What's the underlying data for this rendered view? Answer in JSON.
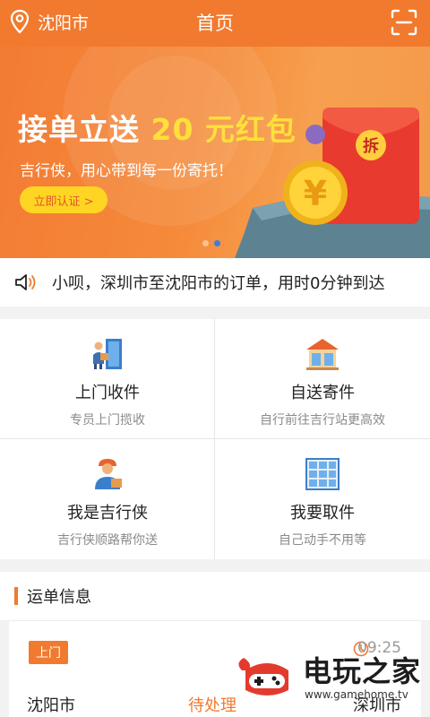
{
  "header": {
    "location": "沈阳市",
    "title": "首页",
    "location_icon": "location-pin-icon",
    "scan_icon": "scan-icon"
  },
  "banner": {
    "headline_prefix": "接单立送",
    "headline_highlight": "20 元红包",
    "subtitle": "吉行侠，用心带到每一份寄托！",
    "cta": "立即认证 >",
    "envelope_char": "拆",
    "coin_char": "¥",
    "slide_count": 2,
    "active_slide": 2
  },
  "notice": {
    "icon": "speaker-icon",
    "text": "小呗，深圳市至沈阳市的订单，用时0分钟到达"
  },
  "services": [
    {
      "label": "上门收件",
      "sub": "专员上门揽收",
      "icon": "courier-door-icon"
    },
    {
      "label": "自送寄件",
      "sub": "自行前往吉行站更高效",
      "icon": "station-icon"
    },
    {
      "label": "我是吉行侠",
      "sub": "吉行侠顺路帮你送",
      "icon": "courier-person-icon"
    },
    {
      "label": "我要取件",
      "sub": "自己动手不用等",
      "icon": "locker-icon"
    }
  ],
  "waybill": {
    "section_title": "运单信息",
    "tag": "上门",
    "time": "09:25",
    "from": "沈阳市",
    "status": "待处理",
    "to": "深圳市"
  },
  "watermark": {
    "name": "电玩之家",
    "url": "www.gamehome.tv"
  },
  "colors": {
    "accent": "#f17a2e",
    "highlight": "#ffe03a",
    "button": "#ffd523",
    "active_dot": "#3c7edb"
  }
}
